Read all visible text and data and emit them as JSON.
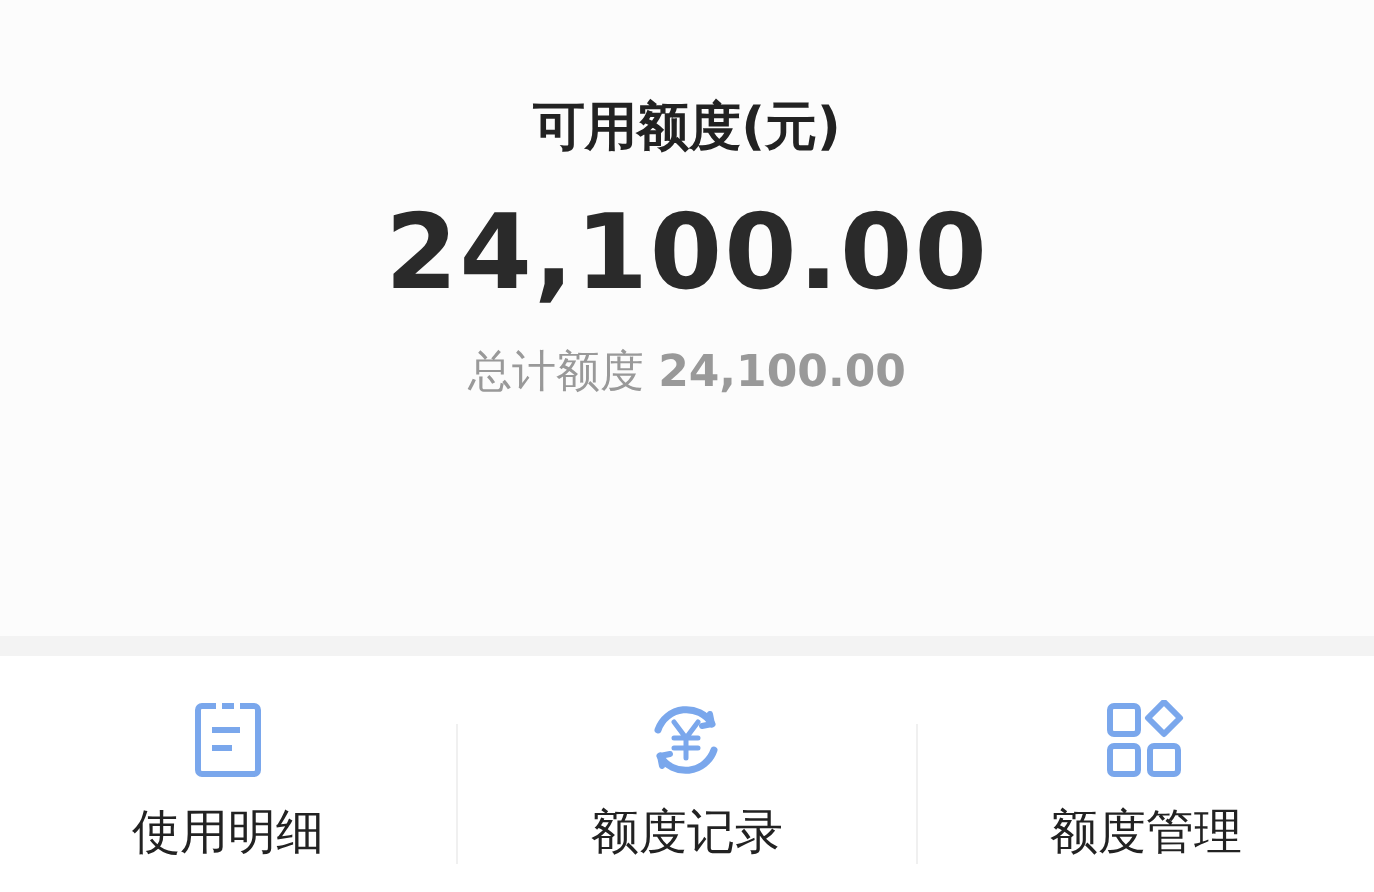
{
  "balance": {
    "title": "可用额度(元)",
    "amount": "24,100.00",
    "total": "总计额度 **24,100.00**"
  },
  "actions": [
    {
      "kind": "details",
      "label": "使用明细"
    },
    {
      "kind": "records",
      "label": "额度记录"
    },
    {
      "kind": "manage",
      "label": "额度管理"
    }
  ]
}
